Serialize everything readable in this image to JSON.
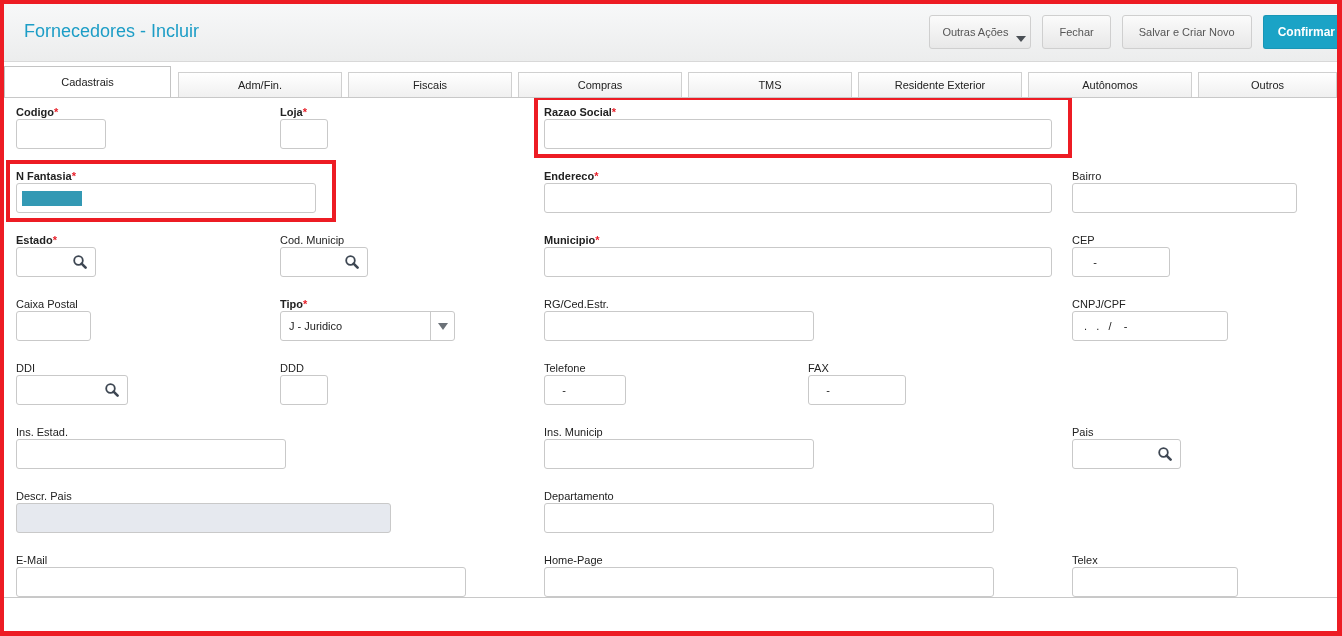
{
  "header": {
    "title": "Fornecedores - Incluir",
    "buttons": [
      {
        "label": "Outras Ações",
        "kind": "dropdown"
      },
      {
        "label": "Fechar",
        "kind": "default"
      },
      {
        "label": "Salvar e Criar Novo",
        "kind": "default"
      },
      {
        "label": "Confirmar",
        "kind": "primary"
      }
    ]
  },
  "tabs": [
    {
      "label": "Cadastrais",
      "selected": true
    },
    {
      "label": "Adm/Fin.",
      "selected": false
    },
    {
      "label": "Fiscais",
      "selected": false
    },
    {
      "label": "Compras",
      "selected": false
    },
    {
      "label": "TMS",
      "selected": false
    },
    {
      "label": "Residente Exterior",
      "selected": false
    },
    {
      "label": "Autônomos",
      "selected": false
    },
    {
      "label": "Outros",
      "selected": false
    }
  ],
  "form": {
    "rows": [
      [
        {
          "label": "Codigo",
          "required": true,
          "marker": "*",
          "kind": "text",
          "disabled": false,
          "highlighted": false,
          "text_selected": false
        },
        {
          "label": "Loja",
          "required": true,
          "marker": "*",
          "kind": "text",
          "disabled": false,
          "highlighted": false,
          "text_selected": false
        },
        {
          "label": "Razao Social",
          "required": true,
          "marker": "*",
          "kind": "text",
          "disabled": false,
          "highlighted": true,
          "text_selected": false
        }
      ],
      [
        {
          "label": "N Fantasia",
          "required": true,
          "marker": "*",
          "kind": "text",
          "disabled": false,
          "highlighted": true,
          "text_selected": true
        },
        {
          "label": "Endereco",
          "required": true,
          "marker": "*",
          "kind": "text",
          "disabled": false,
          "highlighted": false,
          "text_selected": false
        },
        {
          "label": "Bairro",
          "required": false,
          "kind": "text",
          "disabled": false,
          "highlighted": false,
          "text_selected": false
        }
      ],
      [
        {
          "label": "Estado",
          "required": true,
          "marker": "*",
          "kind": "lookup",
          "disabled": false,
          "highlighted": false,
          "text_selected": false
        },
        {
          "label": "Cod. Municip",
          "required": false,
          "kind": "lookup",
          "disabled": false,
          "highlighted": false,
          "text_selected": false
        },
        {
          "label": "Municipio",
          "required": true,
          "marker": "*",
          "kind": "text",
          "disabled": false,
          "highlighted": false,
          "text_selected": false
        },
        {
          "label": "CEP",
          "required": false,
          "kind": "text",
          "value": "    -",
          "disabled": false,
          "highlighted": false,
          "text_selected": false
        }
      ],
      [
        {
          "label": "Caixa Postal",
          "required": false,
          "kind": "text",
          "disabled": false,
          "highlighted": false,
          "text_selected": false
        },
        {
          "label": "Tipo",
          "required": true,
          "marker": "*",
          "kind": "select",
          "value": "J - Juridico",
          "disabled": false,
          "highlighted": false,
          "text_selected": false
        },
        {
          "label": "RG/Ced.Estr.",
          "required": false,
          "kind": "text",
          "disabled": false,
          "highlighted": false,
          "text_selected": false
        },
        {
          "label": "CNPJ/CPF",
          "required": false,
          "kind": "text",
          "value": " .   .   /    -",
          "disabled": false,
          "highlighted": false,
          "text_selected": false
        }
      ],
      [
        {
          "label": "DDI",
          "required": false,
          "kind": "lookup",
          "disabled": false,
          "highlighted": false,
          "text_selected": false
        },
        {
          "label": "DDD",
          "required": false,
          "kind": "text",
          "disabled": false,
          "highlighted": false,
          "text_selected": false
        },
        {
          "label": "Telefone",
          "required": false,
          "kind": "text",
          "value": "   -",
          "disabled": false,
          "highlighted": false,
          "text_selected": false
        },
        {
          "label": "FAX",
          "required": false,
          "kind": "text",
          "value": "   -",
          "disabled": false,
          "highlighted": false,
          "text_selected": false
        }
      ],
      [
        {
          "label": "Ins. Estad.",
          "required": false,
          "kind": "text",
          "disabled": false,
          "highlighted": false,
          "text_selected": false
        },
        {
          "label": "Ins. Municip",
          "required": false,
          "kind": "text",
          "disabled": false,
          "highlighted": false,
          "text_selected": false
        },
        {
          "label": "Pais",
          "required": false,
          "kind": "lookup",
          "disabled": false,
          "highlighted": false,
          "text_selected": false
        }
      ],
      [
        {
          "label": "Descr. Pais",
          "required": false,
          "kind": "text",
          "disabled": true,
          "highlighted": false,
          "text_selected": false
        },
        {
          "label": "Departamento",
          "required": false,
          "kind": "text",
          "disabled": false,
          "highlighted": false,
          "text_selected": false
        }
      ],
      [
        {
          "label": "E-Mail",
          "required": false,
          "kind": "text",
          "disabled": false,
          "highlighted": false,
          "text_selected": false
        },
        {
          "label": "Home-Page",
          "required": false,
          "kind": "text",
          "disabled": false,
          "highlighted": false,
          "text_selected": false
        },
        {
          "label": "Telex",
          "required": false,
          "kind": "text",
          "disabled": false,
          "highlighted": false,
          "text_selected": false
        }
      ]
    ]
  }
}
